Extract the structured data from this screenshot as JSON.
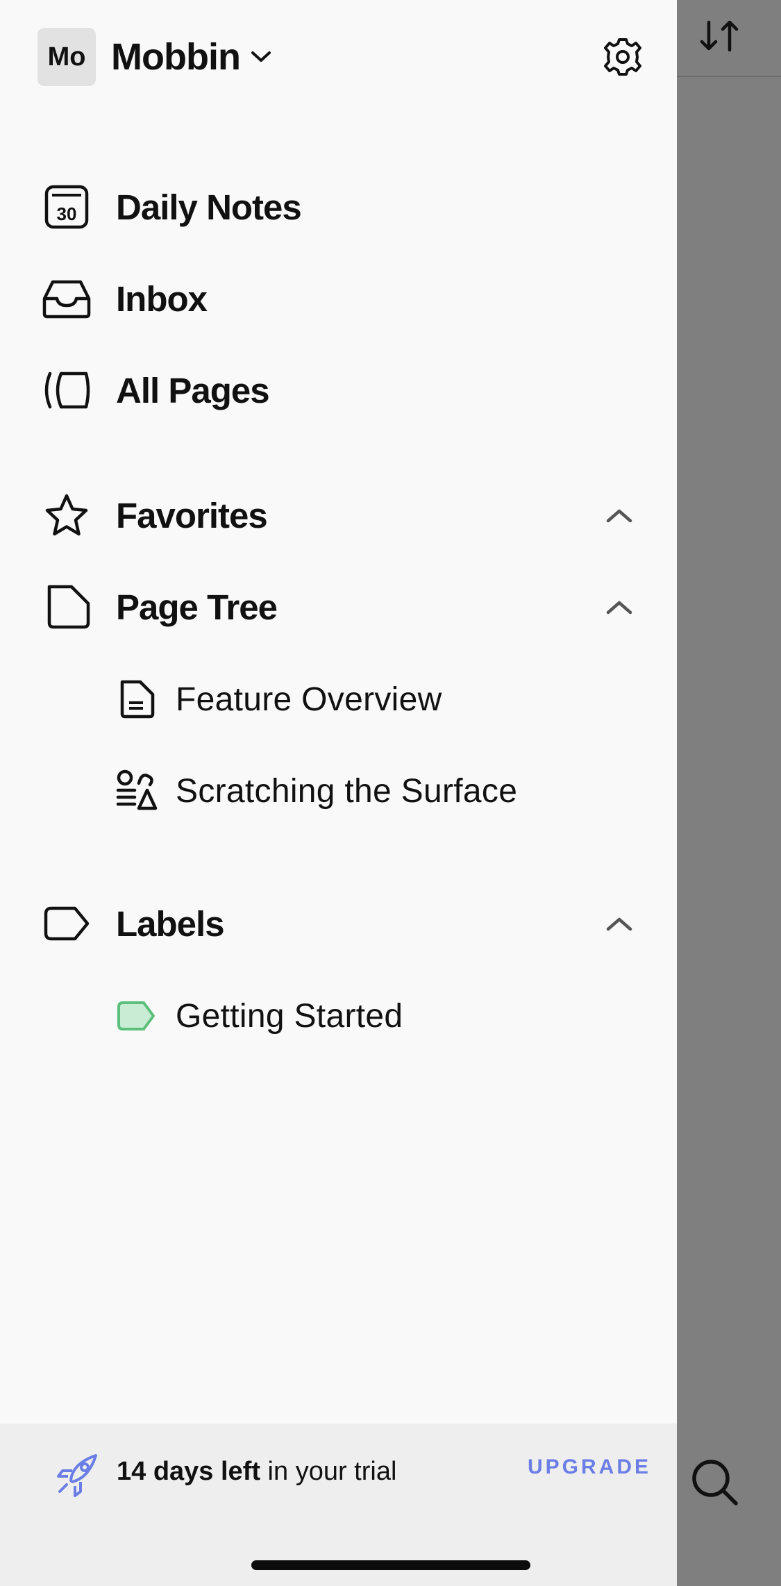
{
  "header": {
    "avatar_text": "Mo",
    "workspace_name": "Mobbin"
  },
  "nav": {
    "daily_notes": "Daily Notes",
    "inbox": "Inbox",
    "all_pages": "All Pages"
  },
  "sections": {
    "favorites": "Favorites",
    "page_tree": "Page Tree",
    "labels": "Labels"
  },
  "page_tree_items": [
    "Feature Overview",
    "Scratching the Surface"
  ],
  "label_items": [
    "Getting Started"
  ],
  "calendar_day": "30",
  "footer": {
    "trial_bold": "14 days left",
    "trial_rest": " in your trial",
    "upgrade": "UPGRADE"
  },
  "colors": {
    "accent": "#6b7ee6",
    "label_green": "#c9ecd4",
    "label_green_border": "#5cc07c",
    "overlay": "#7f7f7f"
  }
}
